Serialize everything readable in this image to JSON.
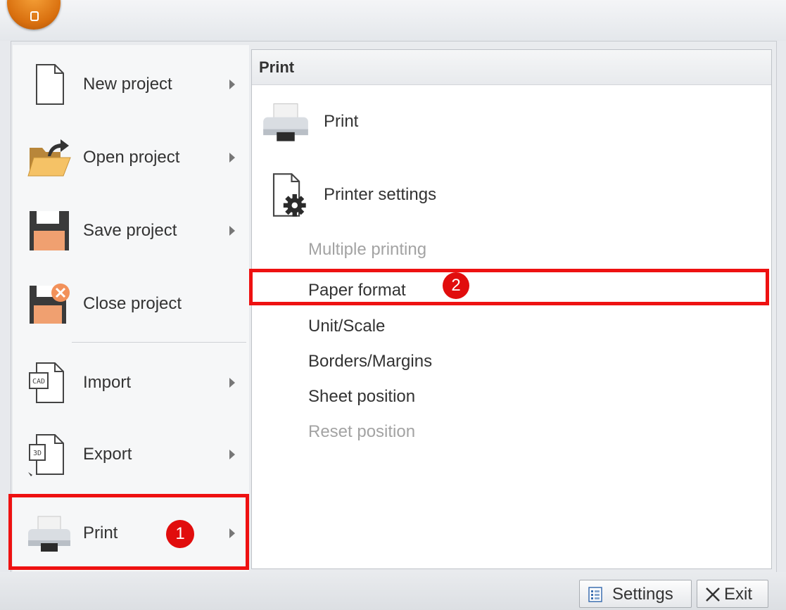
{
  "left_menu": {
    "items": [
      {
        "label": "New project",
        "icon": "new-document-icon",
        "has_submenu": true
      },
      {
        "label": "Open project",
        "icon": "open-folder-icon",
        "has_submenu": true
      },
      {
        "label": "Save project",
        "icon": "floppy-disk-icon",
        "has_submenu": true
      },
      {
        "label": "Close project",
        "icon": "close-project-icon",
        "has_submenu": false
      },
      {
        "label": "Import",
        "icon": "import-cad-file-icon",
        "has_submenu": true
      },
      {
        "label": "Export",
        "icon": "export-3d-file-icon",
        "has_submenu": true
      },
      {
        "label": "Print",
        "icon": "printer-icon",
        "has_submenu": true,
        "selected": true
      }
    ]
  },
  "submenu": {
    "title": "Print",
    "primary_items": [
      {
        "label": "Print",
        "icon": "printer-icon"
      },
      {
        "label": "Printer settings",
        "icon": "printer-settings-gear-icon"
      }
    ],
    "items": [
      {
        "label": "Multiple printing",
        "enabled": false
      },
      {
        "label": "Paper format",
        "enabled": true,
        "highlighted": true
      },
      {
        "label": "Unit/Scale",
        "enabled": true
      },
      {
        "label": "Borders/Margins",
        "enabled": true
      },
      {
        "label": "Sheet position",
        "enabled": true
      },
      {
        "label": "Reset position",
        "enabled": false
      }
    ]
  },
  "callouts": {
    "step1": "1",
    "step2": "2"
  },
  "bottom_bar": {
    "settings_label": "Settings",
    "exit_label": "Exit"
  },
  "colors": {
    "highlight": "#ee1111",
    "badge": "#e10d0d",
    "app_orb": "#e8860f",
    "disabled_text": "#a3a3a3"
  }
}
